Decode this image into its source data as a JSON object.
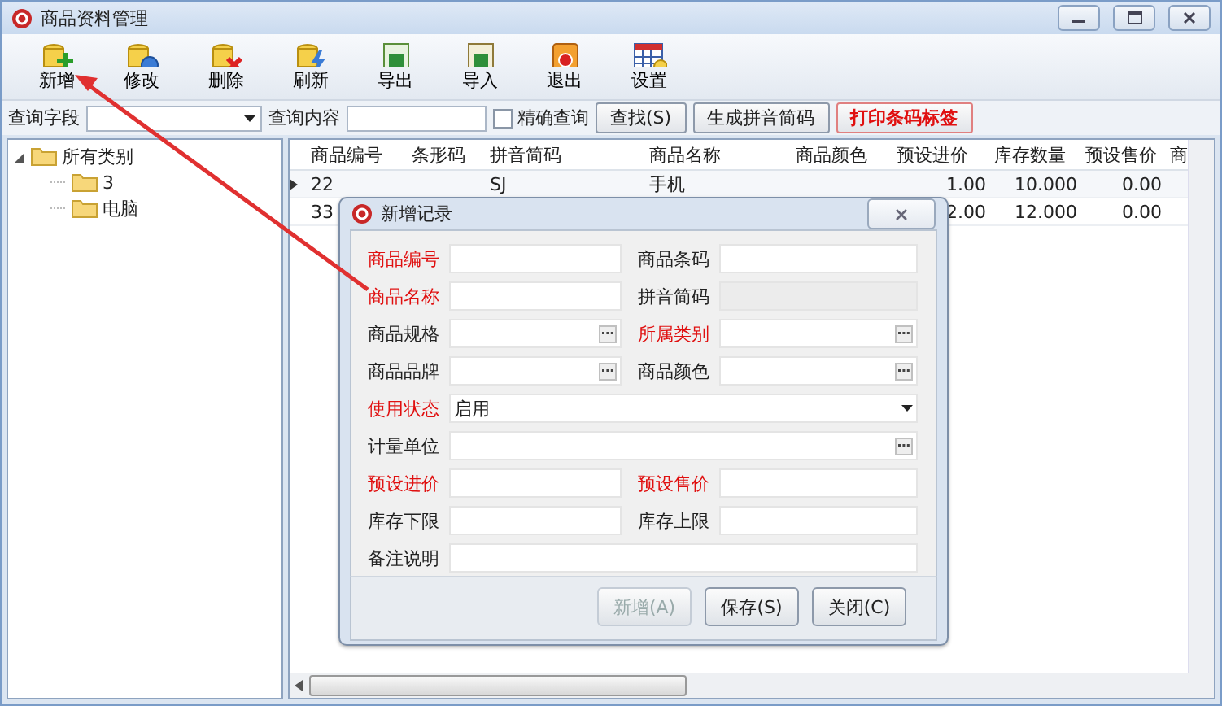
{
  "window": {
    "title": "商品资料管理"
  },
  "toolbar": [
    {
      "label": "新增"
    },
    {
      "label": "修改"
    },
    {
      "label": "删除"
    },
    {
      "label": "刷新"
    },
    {
      "label": "导出"
    },
    {
      "label": "导入"
    },
    {
      "label": "退出"
    },
    {
      "label": "设置"
    }
  ],
  "query": {
    "field_label": "查询字段",
    "content_label": "查询内容",
    "exact": {
      "label": "精确查询",
      "checked": false
    },
    "buttons": [
      {
        "label": "查找(S)",
        "kind": "normal"
      },
      {
        "label": "生成拼音简码",
        "kind": "normal"
      },
      {
        "label": "打印条码标签",
        "kind": "accent"
      }
    ]
  },
  "tree": [
    {
      "label": "所有类别",
      "expanded": true,
      "children": [
        {
          "label": "3"
        },
        {
          "label": "电脑"
        }
      ]
    }
  ],
  "table": {
    "columns": [
      "商品编号",
      "条形码",
      "拼音简码",
      "商品名称",
      "商品颜色",
      "预设进价",
      "库存数量",
      "预设售价",
      "商"
    ],
    "rows": [
      {
        "selected": true,
        "cells": [
          "22",
          null,
          "SJ",
          "手机",
          null,
          "1.00",
          "10.000",
          "0.00",
          null
        ]
      },
      {
        "selected": false,
        "cells": [
          "33",
          null,
          null,
          null,
          null,
          "2.00",
          "12.000",
          "0.00",
          null
        ]
      }
    ]
  },
  "dialog": {
    "title": "新增记录",
    "fields": [
      {
        "label": "商品编号",
        "required": true,
        "kind": "text",
        "wide": false
      },
      {
        "label": "商品条码",
        "required": false,
        "kind": "text",
        "wide": false
      },
      {
        "label": "商品名称",
        "required": true,
        "kind": "text",
        "wide": false
      },
      {
        "label": "拼音简码",
        "required": false,
        "kind": "readonly",
        "wide": false
      },
      {
        "label": "商品规格",
        "required": false,
        "kind": "browse",
        "wide": false
      },
      {
        "label": "所属类别",
        "required": true,
        "kind": "browse",
        "wide": false
      },
      {
        "label": "商品品牌",
        "required": false,
        "kind": "browse",
        "wide": false
      },
      {
        "label": "商品颜色",
        "required": false,
        "kind": "browse",
        "wide": false
      },
      {
        "label": "使用状态",
        "required": true,
        "kind": "select",
        "wide": true,
        "value": "启用"
      },
      {
        "label": "计量单位",
        "required": false,
        "kind": "browse",
        "wide": true
      },
      {
        "label": "预设进价",
        "required": true,
        "kind": "text",
        "wide": false
      },
      {
        "label": "预设售价",
        "required": true,
        "kind": "text",
        "wide": false
      },
      {
        "label": "库存下限",
        "required": false,
        "kind": "text",
        "wide": false
      },
      {
        "label": "库存上限",
        "required": false,
        "kind": "text",
        "wide": false
      },
      {
        "label": "备注说明",
        "required": false,
        "kind": "text",
        "wide": true
      }
    ],
    "buttons": [
      {
        "label": "新增(A)",
        "disabled": true
      },
      {
        "label": "保存(S)",
        "disabled": false
      },
      {
        "label": "关闭(C)",
        "disabled": false
      }
    ]
  }
}
